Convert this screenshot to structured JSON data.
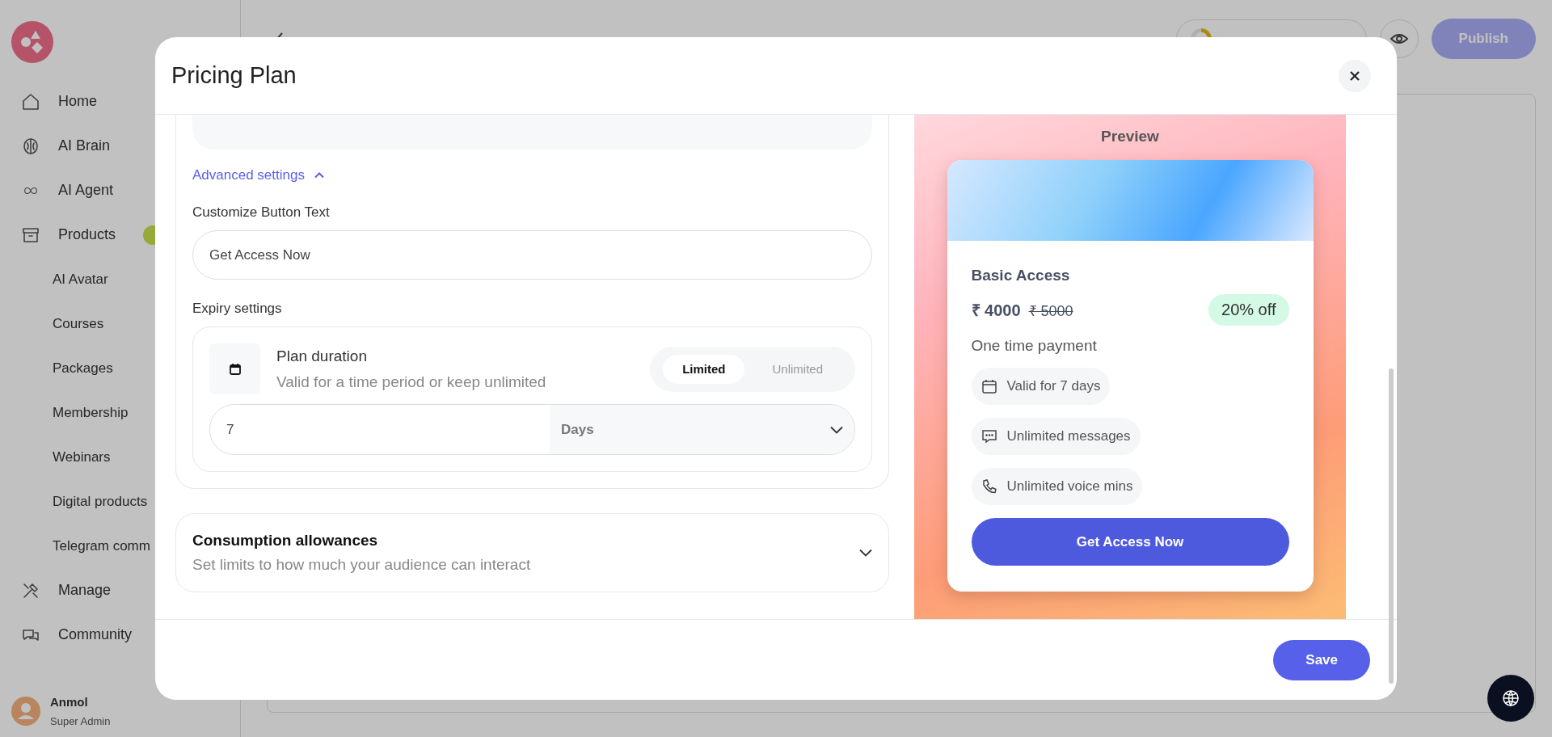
{
  "sidebar": {
    "items": [
      {
        "label": "Home"
      },
      {
        "label": "AI Brain"
      },
      {
        "label": "AI Agent"
      },
      {
        "label": "Products",
        "children": [
          {
            "label": "AI Avatar"
          },
          {
            "label": "Courses"
          },
          {
            "label": "Packages"
          },
          {
            "label": "Membership"
          },
          {
            "label": "Webinars"
          },
          {
            "label": "Digital products"
          },
          {
            "label": "Telegram comm"
          }
        ]
      },
      {
        "label": "Manage"
      },
      {
        "label": "Community"
      }
    ],
    "user": {
      "name": "Anmol",
      "role": "Super Admin"
    }
  },
  "header": {
    "publish": "Publish"
  },
  "modal": {
    "title": "Pricing Plan",
    "advanced_toggle": {
      "label": "Advanced settings",
      "expanded": true
    },
    "button_text": {
      "label": "Customize Button Text",
      "value": "Get Access Now"
    },
    "expiry": {
      "label": "Expiry settings",
      "title": "Plan duration",
      "description": "Valid for a time period or keep unlimited",
      "options": [
        {
          "label": "Limited",
          "selected": true
        },
        {
          "label": "Unlimited",
          "selected": false
        }
      ],
      "amount": "7",
      "unit": "Days"
    },
    "consumption": {
      "title": "Consumption allowances",
      "description": "Set limits to how much your audience can interact",
      "expanded": false
    },
    "preview": {
      "heading": "Preview",
      "plan_name": "Basic Access",
      "price": "₹ 4000",
      "original_price": "₹ 5000",
      "discount": "20% off",
      "payment_type": "One time payment",
      "features": [
        "Valid for 7 days",
        "Unlimited messages",
        "Unlimited voice mins"
      ],
      "cta": "Get Access Now"
    },
    "save": "Save"
  }
}
